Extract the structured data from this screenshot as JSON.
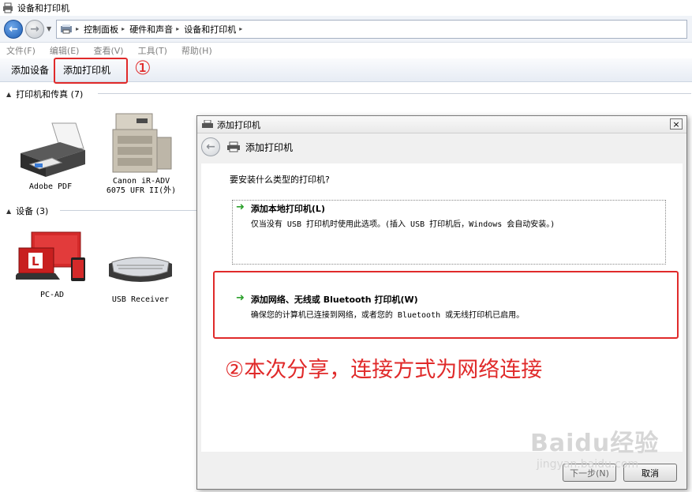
{
  "window": {
    "title": "设备和打印机"
  },
  "address": {
    "breadcrumbs": [
      "控制面板",
      "硬件和声音",
      "设备和打印机"
    ]
  },
  "menu": [
    "文件(F)",
    "编辑(E)",
    "查看(V)",
    "工具(T)",
    "帮助(H)"
  ],
  "toolbar": {
    "add_device": "添加设备",
    "add_printer": "添加打印机",
    "step1_mark": "①"
  },
  "groups": {
    "printers": {
      "label": "打印机和传真 (7)"
    },
    "devices": {
      "label": "设备 (3)"
    }
  },
  "printers": [
    {
      "name": "Adobe PDF",
      "icon": "printer-icon"
    },
    {
      "name": "Canon iR-ADV 6075 UFR II(外)",
      "line1": "Canon iR-ADV",
      "line2": "6075 UFR II(外)",
      "icon": "copier-icon"
    }
  ],
  "devices": [
    {
      "name": "PC-AD",
      "icon": "computer-icon"
    },
    {
      "name": "USB Receiver",
      "icon": "keyboard-icon"
    }
  ],
  "dialog": {
    "title": "添加打印机",
    "nav_title": "添加打印机",
    "question": "要安装什么类型的打印机?",
    "option_local_title": "添加本地打印机(L)",
    "option_local_desc": "仅当没有 USB 打印机时使用此选项。(插入 USB 打印机后，Windows 会自动安装。)",
    "option_network_title": "添加网络、无线或 Bluetooth 打印机(W)",
    "option_network_desc": "确保您的计算机已连接到网络，或者您的 Bluetooth 或无线打印机已启用。",
    "next_label": "下一步(N)",
    "cancel_label": "取消",
    "close_glyph": "×"
  },
  "annotation": {
    "step2_note": "②本次分享，连接方式为网络连接"
  },
  "watermark": {
    "brand": "Baidu经验",
    "url": "jingyan.baidu.com"
  },
  "colors": {
    "highlight": "#e02a2a",
    "option_arrow": "#2ca02c"
  }
}
